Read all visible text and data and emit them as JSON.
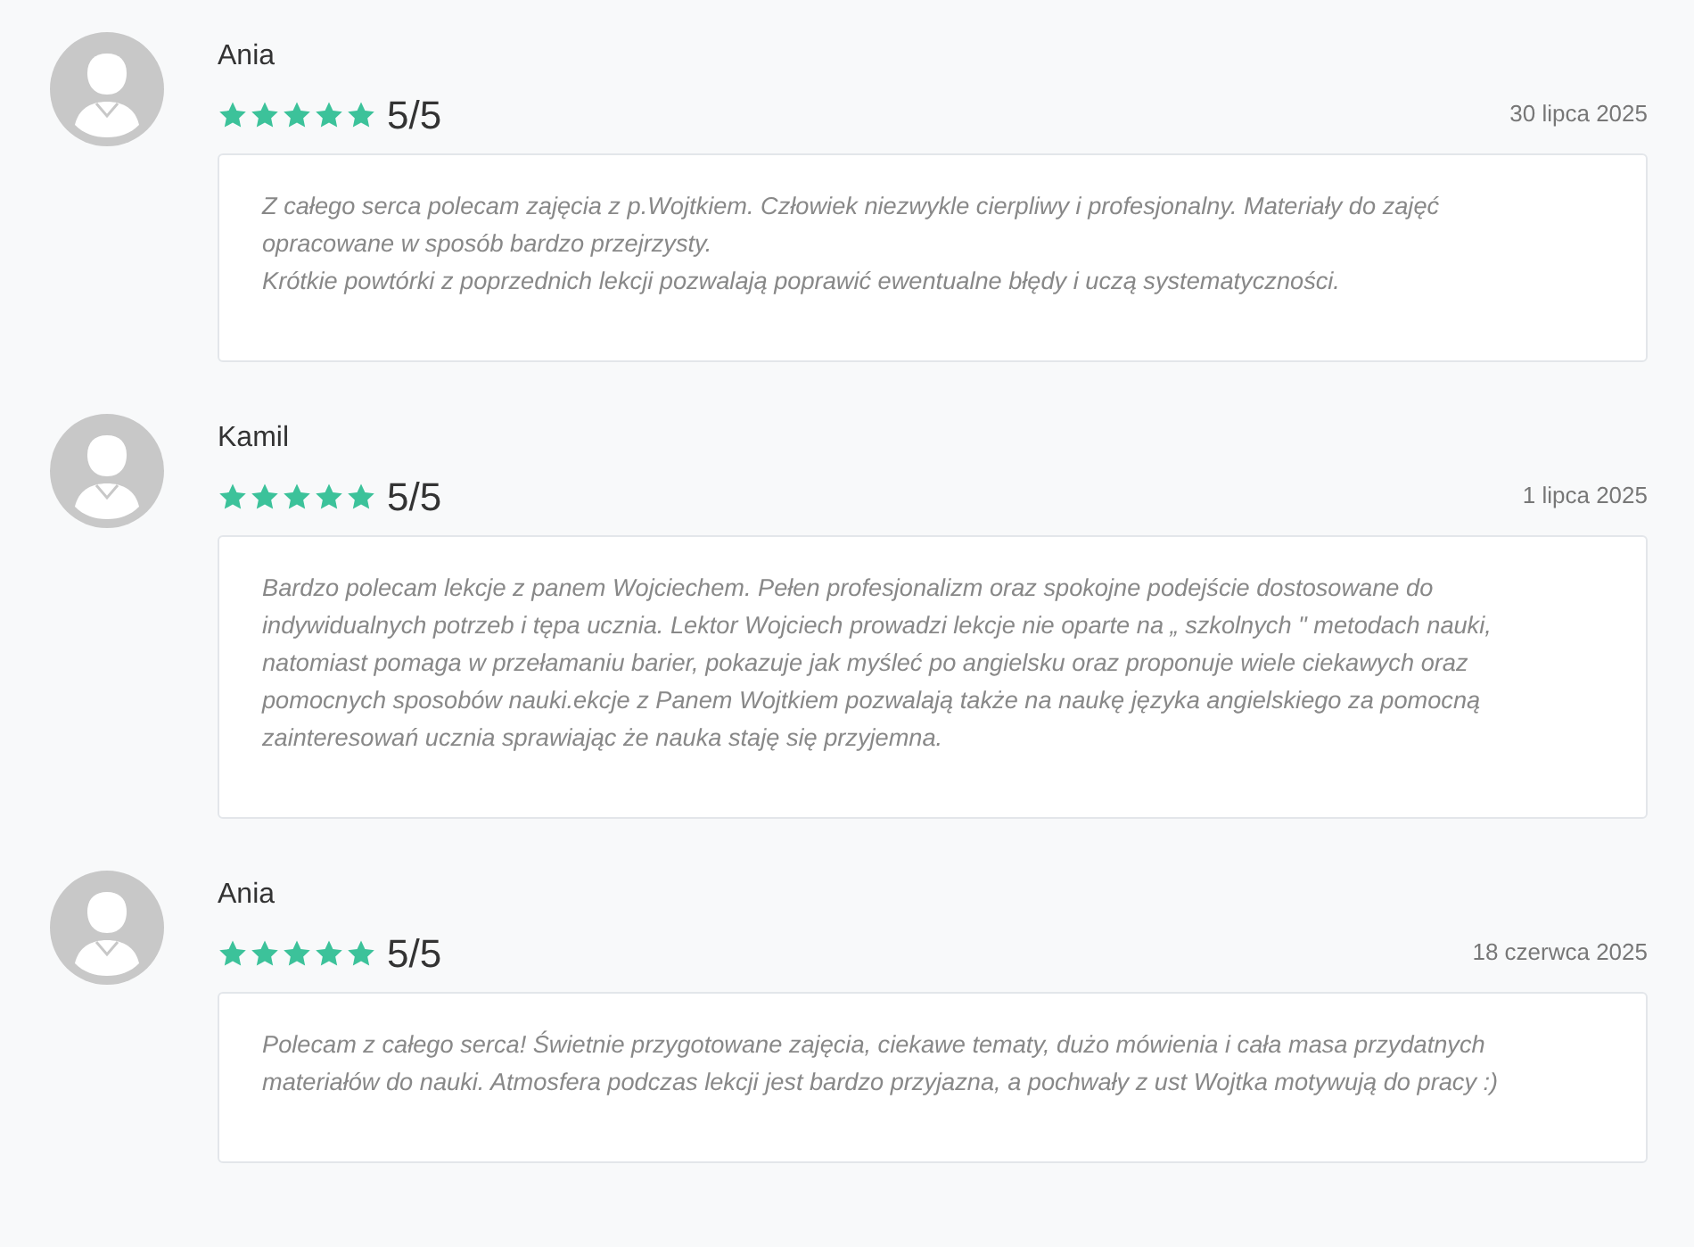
{
  "reviews": [
    {
      "name": "Ania",
      "stars": 5,
      "rating": "5/5",
      "date": "30 lipca 2025",
      "text": "Z całego serca polecam zajęcia z p.Wojtkiem. Człowiek niezwykle cierpliwy i profesjonalny. Materiały do zajęć opracowane w sposób bardzo przejrzysty.\nKrótkie powtórki z poprzednich lekcji pozwalają poprawić ewentualne błędy i uczą systematyczności."
    },
    {
      "name": "Kamil",
      "stars": 5,
      "rating": "5/5",
      "date": "1 lipca 2025",
      "text": "Bardzo polecam lekcje z panem Wojciechem. Pełen profesjonalizm oraz spokojne podejście dostosowane do indywidualnych potrzeb i tępa ucznia. Lektor Wojciech prowadzi lekcje nie oparte na „ szkolnych \" metodach nauki, natomiast pomaga w przełamaniu barier, pokazuje jak myśleć po angielsku oraz proponuje wiele ciekawych oraz pomocnych sposobów nauki.ekcje z Panem Wojtkiem pozwalają także na naukę języka angielskiego za pomocną zainteresowań ucznia sprawiając że nauka staję się przyjemna."
    },
    {
      "name": "Ania",
      "stars": 5,
      "rating": "5/5",
      "date": "18 czerwca 2025",
      "text": "Polecam z całego serca! Świetnie przygotowane zajęcia, ciekawe tematy, dużo mówienia i cała masa przydatnych materiałów do nauki. Atmosfera podczas lekcji jest bardzo przyjazna, a pochwały z ust Wojtka motywują do pracy :)"
    }
  ]
}
